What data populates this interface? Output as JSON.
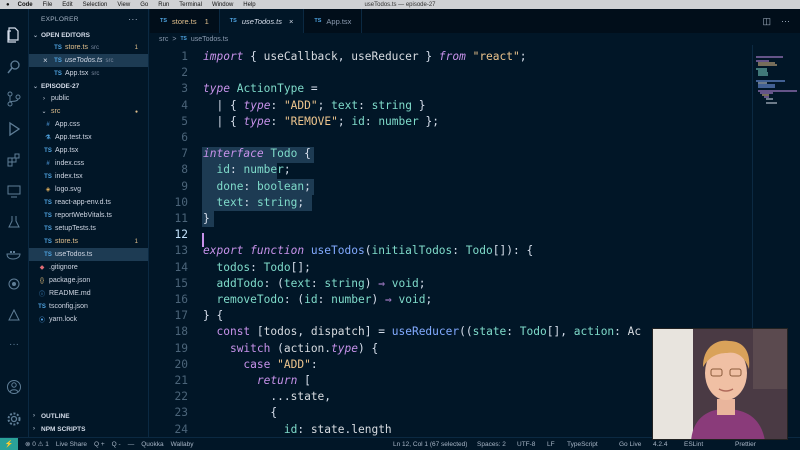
{
  "menubar": {
    "items": [
      "Code",
      "File",
      "Edit",
      "Selection",
      "View",
      "Go",
      "Run",
      "Terminal",
      "Window",
      "Help"
    ],
    "window_title": "useTodos.ts — episode-27"
  },
  "explorer": {
    "header": "EXPLORER",
    "more": "···",
    "open_editors": {
      "label": "OPEN EDITORS",
      "items": [
        {
          "name": "store.ts",
          "note": "src",
          "count": "1"
        },
        {
          "name": "useTodos.ts",
          "note": "src",
          "count": ""
        },
        {
          "name": "App.tsx",
          "note": "src",
          "count": ""
        }
      ]
    },
    "project": {
      "label": "EPISODE-27",
      "items": [
        {
          "name": "public",
          "count": ""
        },
        {
          "name": "src",
          "count": "●"
        },
        {
          "name": "App.css",
          "count": ""
        },
        {
          "name": "App.test.tsx",
          "count": ""
        },
        {
          "name": "App.tsx",
          "count": ""
        },
        {
          "name": "index.css",
          "count": ""
        },
        {
          "name": "index.tsx",
          "count": ""
        },
        {
          "name": "logo.svg",
          "count": ""
        },
        {
          "name": "react-app-env.d.ts",
          "count": ""
        },
        {
          "name": "reportWebVitals.ts",
          "count": ""
        },
        {
          "name": "setupTests.ts",
          "count": ""
        },
        {
          "name": "store.ts",
          "count": "1"
        },
        {
          "name": "useTodos.ts",
          "count": ""
        },
        {
          "name": ".gitignore",
          "count": ""
        },
        {
          "name": "package.json",
          "count": ""
        },
        {
          "name": "README.md",
          "count": ""
        },
        {
          "name": "tsconfig.json",
          "count": ""
        },
        {
          "name": "yarn.lock",
          "count": ""
        }
      ]
    },
    "outline": "OUTLINE",
    "npm_scripts": "NPM SCRIPTS"
  },
  "tabs": [
    {
      "label": "store.ts",
      "extra": "1"
    },
    {
      "label": "useTodos.ts",
      "extra": "×"
    },
    {
      "label": "App.tsx",
      "extra": ""
    }
  ],
  "tab_icon": "TS",
  "breadcrumb": {
    "folder": "src",
    "sep": ">",
    "file": "useTodos.ts"
  },
  "editor": {
    "lines": [
      {
        "n": "1",
        "text": "import { useCallback, useReducer } from \"react\";"
      },
      {
        "n": "2",
        "text": ""
      },
      {
        "n": "3",
        "text": "type ActionType ="
      },
      {
        "n": "4",
        "text": "  | { type: \"ADD\"; text: string }"
      },
      {
        "n": "5",
        "text": "  | { type: \"REMOVE\"; id: number };"
      },
      {
        "n": "6",
        "text": ""
      },
      {
        "n": "7",
        "text": "interface Todo {"
      },
      {
        "n": "8",
        "text": "  id: number;"
      },
      {
        "n": "9",
        "text": "  done: boolean;"
      },
      {
        "n": "10",
        "text": "  text: string;"
      },
      {
        "n": "11",
        "text": "}"
      },
      {
        "n": "12",
        "text": ""
      },
      {
        "n": "13",
        "text": "export function useTodos(initialTodos: Todo[]): {"
      },
      {
        "n": "14",
        "text": "  todos: Todo[];"
      },
      {
        "n": "15",
        "text": "  addTodo: (text: string) ⇒ void;"
      },
      {
        "n": "16",
        "text": "  removeTodo: (id: number) ⇒ void;"
      },
      {
        "n": "17",
        "text": "} {"
      },
      {
        "n": "18",
        "text": "  const [todos, dispatch] = useReducer((state: Todo[], action: Ac"
      },
      {
        "n": "19",
        "text": "    switch (action.type) {"
      },
      {
        "n": "20",
        "text": "      case \"ADD\":"
      },
      {
        "n": "21",
        "text": "        return ["
      },
      {
        "n": "22",
        "text": "          ...state,"
      },
      {
        "n": "23",
        "text": "          {"
      },
      {
        "n": "24",
        "text": "            id: state.length"
      }
    ],
    "current_line": "12"
  },
  "status": {
    "remote": "⚡",
    "problems": "⊗ 0 ⚠ 1",
    "live_share": "Live Share",
    "q_plus": "Q +",
    "q_minus": "Q -",
    "quokka": "Quokka",
    "wallaby": "Wallaby",
    "position": "Ln 12, Col 1 (67 selected)",
    "spaces": "Spaces: 2",
    "encoding": "UTF-8",
    "eol": "LF",
    "language": "TypeScript",
    "go_live": "Go Live",
    "version": "4.2.4",
    "eslint": "ESLint",
    "prettier": "Prettier"
  },
  "colors": {
    "background": "#011627",
    "selection": "#1d3b53",
    "keyword": "#c792ea",
    "string": "#ecc48d",
    "function": "#82aaff",
    "type": "#7fdbca"
  }
}
